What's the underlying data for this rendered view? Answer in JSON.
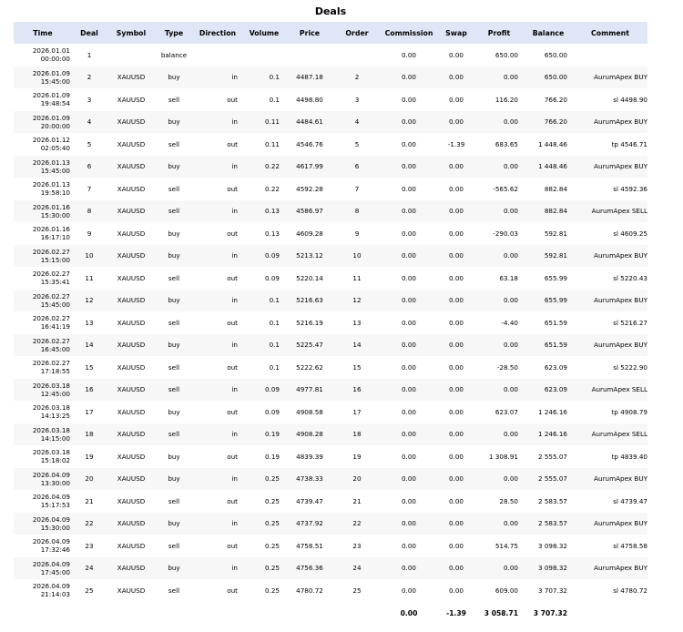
{
  "title": "Deals",
  "columns": [
    "Time",
    "Deal",
    "Symbol",
    "Type",
    "Direction",
    "Volume",
    "Price",
    "Order",
    "Commission",
    "Swap",
    "Profit",
    "Balance",
    "Comment"
  ],
  "rows": [
    {
      "date": "2026.01.01",
      "time": "00:00:00",
      "deal": "1",
      "symbol": "",
      "type": "balance",
      "direction": "",
      "volume": "",
      "price": "",
      "order": "",
      "commission": "0.00",
      "swap": "0.00",
      "profit": "650.00",
      "balance": "650.00",
      "comment": ""
    },
    {
      "date": "2026.01.09",
      "time": "15:45:00",
      "deal": "2",
      "symbol": "XAUUSD",
      "type": "buy",
      "direction": "in",
      "volume": "0.1",
      "price": "4487.18",
      "order": "2",
      "commission": "0.00",
      "swap": "0.00",
      "profit": "0.00",
      "balance": "650.00",
      "comment": "AurumApex BUY"
    },
    {
      "date": "2026.01.09",
      "time": "19:48:54",
      "deal": "3",
      "symbol": "XAUUSD",
      "type": "sell",
      "direction": "out",
      "volume": "0.1",
      "price": "4498.80",
      "order": "3",
      "commission": "0.00",
      "swap": "0.00",
      "profit": "116.20",
      "balance": "766.20",
      "comment": "sl 4498.90"
    },
    {
      "date": "2026.01.09",
      "time": "20:00:00",
      "deal": "4",
      "symbol": "XAUUSD",
      "type": "buy",
      "direction": "in",
      "volume": "0.11",
      "price": "4484.61",
      "order": "4",
      "commission": "0.00",
      "swap": "0.00",
      "profit": "0.00",
      "balance": "766.20",
      "comment": "AurumApex BUY"
    },
    {
      "date": "2026.01.12",
      "time": "02:05:40",
      "deal": "5",
      "symbol": "XAUUSD",
      "type": "sell",
      "direction": "out",
      "volume": "0.11",
      "price": "4546.76",
      "order": "5",
      "commission": "0.00",
      "swap": "-1.39",
      "profit": "683.65",
      "balance": "1 448.46",
      "comment": "tp 4546.71"
    },
    {
      "date": "2026.01.13",
      "time": "15:45:00",
      "deal": "6",
      "symbol": "XAUUSD",
      "type": "buy",
      "direction": "in",
      "volume": "0.22",
      "price": "4617.99",
      "order": "6",
      "commission": "0.00",
      "swap": "0.00",
      "profit": "0.00",
      "balance": "1 448.46",
      "comment": "AurumApex BUY"
    },
    {
      "date": "2026.01.13",
      "time": "19:58:10",
      "deal": "7",
      "symbol": "XAUUSD",
      "type": "sell",
      "direction": "out",
      "volume": "0.22",
      "price": "4592.28",
      "order": "7",
      "commission": "0.00",
      "swap": "0.00",
      "profit": "-565.62",
      "balance": "882.84",
      "comment": "sl 4592.36"
    },
    {
      "date": "2026.01.16",
      "time": "15:30:00",
      "deal": "8",
      "symbol": "XAUUSD",
      "type": "sell",
      "direction": "in",
      "volume": "0.13",
      "price": "4586.97",
      "order": "8",
      "commission": "0.00",
      "swap": "0.00",
      "profit": "0.00",
      "balance": "882.84",
      "comment": "AurumApex SELL"
    },
    {
      "date": "2026.01.16",
      "time": "16:17:10",
      "deal": "9",
      "symbol": "XAUUSD",
      "type": "buy",
      "direction": "out",
      "volume": "0.13",
      "price": "4609.28",
      "order": "9",
      "commission": "0.00",
      "swap": "0.00",
      "profit": "-290.03",
      "balance": "592.81",
      "comment": "sl 4609.25"
    },
    {
      "date": "2026.02.27",
      "time": "15:15:00",
      "deal": "10",
      "symbol": "XAUUSD",
      "type": "buy",
      "direction": "in",
      "volume": "0.09",
      "price": "5213.12",
      "order": "10",
      "commission": "0.00",
      "swap": "0.00",
      "profit": "0.00",
      "balance": "592.81",
      "comment": "AurumApex BUY"
    },
    {
      "date": "2026.02.27",
      "time": "15:35:41",
      "deal": "11",
      "symbol": "XAUUSD",
      "type": "sell",
      "direction": "out",
      "volume": "0.09",
      "price": "5220.14",
      "order": "11",
      "commission": "0.00",
      "swap": "0.00",
      "profit": "63.18",
      "balance": "655.99",
      "comment": "sl 5220.43"
    },
    {
      "date": "2026.02.27",
      "time": "15:45:00",
      "deal": "12",
      "symbol": "XAUUSD",
      "type": "buy",
      "direction": "in",
      "volume": "0.1",
      "price": "5216.63",
      "order": "12",
      "commission": "0.00",
      "swap": "0.00",
      "profit": "0.00",
      "balance": "655.99",
      "comment": "AurumApex BUY"
    },
    {
      "date": "2026.02.27",
      "time": "16:41:19",
      "deal": "13",
      "symbol": "XAUUSD",
      "type": "sell",
      "direction": "out",
      "volume": "0.1",
      "price": "5216.19",
      "order": "13",
      "commission": "0.00",
      "swap": "0.00",
      "profit": "-4.40",
      "balance": "651.59",
      "comment": "sl 5216.27"
    },
    {
      "date": "2026.02.27",
      "time": "16:45:00",
      "deal": "14",
      "symbol": "XAUUSD",
      "type": "buy",
      "direction": "in",
      "volume": "0.1",
      "price": "5225.47",
      "order": "14",
      "commission": "0.00",
      "swap": "0.00",
      "profit": "0.00",
      "balance": "651.59",
      "comment": "AurumApex BUY"
    },
    {
      "date": "2026.02.27",
      "time": "17:18:55",
      "deal": "15",
      "symbol": "XAUUSD",
      "type": "sell",
      "direction": "out",
      "volume": "0.1",
      "price": "5222.62",
      "order": "15",
      "commission": "0.00",
      "swap": "0.00",
      "profit": "-28.50",
      "balance": "623.09",
      "comment": "sl 5222.90"
    },
    {
      "date": "2026.03.18",
      "time": "12:45:00",
      "deal": "16",
      "symbol": "XAUUSD",
      "type": "sell",
      "direction": "in",
      "volume": "0.09",
      "price": "4977.81",
      "order": "16",
      "commission": "0.00",
      "swap": "0.00",
      "profit": "0.00",
      "balance": "623.09",
      "comment": "AurumApex SELL"
    },
    {
      "date": "2026.03.18",
      "time": "14:13:25",
      "deal": "17",
      "symbol": "XAUUSD",
      "type": "buy",
      "direction": "out",
      "volume": "0.09",
      "price": "4908.58",
      "order": "17",
      "commission": "0.00",
      "swap": "0.00",
      "profit": "623.07",
      "balance": "1 246.16",
      "comment": "tp 4908.79"
    },
    {
      "date": "2026.03.18",
      "time": "14:15:00",
      "deal": "18",
      "symbol": "XAUUSD",
      "type": "sell",
      "direction": "in",
      "volume": "0.19",
      "price": "4908.28",
      "order": "18",
      "commission": "0.00",
      "swap": "0.00",
      "profit": "0.00",
      "balance": "1 246.16",
      "comment": "AurumApex SELL"
    },
    {
      "date": "2026.03.18",
      "time": "15:18:02",
      "deal": "19",
      "symbol": "XAUUSD",
      "type": "buy",
      "direction": "out",
      "volume": "0.19",
      "price": "4839.39",
      "order": "19",
      "commission": "0.00",
      "swap": "0.00",
      "profit": "1 308.91",
      "balance": "2 555.07",
      "comment": "tp 4839.40"
    },
    {
      "date": "2026.04.09",
      "time": "13:30:00",
      "deal": "20",
      "symbol": "XAUUSD",
      "type": "buy",
      "direction": "in",
      "volume": "0.25",
      "price": "4738.33",
      "order": "20",
      "commission": "0.00",
      "swap": "0.00",
      "profit": "0.00",
      "balance": "2 555.07",
      "comment": "AurumApex BUY"
    },
    {
      "date": "2026.04.09",
      "time": "15:17:53",
      "deal": "21",
      "symbol": "XAUUSD",
      "type": "sell",
      "direction": "out",
      "volume": "0.25",
      "price": "4739.47",
      "order": "21",
      "commission": "0.00",
      "swap": "0.00",
      "profit": "28.50",
      "balance": "2 583.57",
      "comment": "sl 4739.47"
    },
    {
      "date": "2026.04.09",
      "time": "15:30:00",
      "deal": "22",
      "symbol": "XAUUSD",
      "type": "buy",
      "direction": "in",
      "volume": "0.25",
      "price": "4737.92",
      "order": "22",
      "commission": "0.00",
      "swap": "0.00",
      "profit": "0.00",
      "balance": "2 583.57",
      "comment": "AurumApex BUY"
    },
    {
      "date": "2026.04.09",
      "time": "17:32:46",
      "deal": "23",
      "symbol": "XAUUSD",
      "type": "sell",
      "direction": "out",
      "volume": "0.25",
      "price": "4758.51",
      "order": "23",
      "commission": "0.00",
      "swap": "0.00",
      "profit": "514.75",
      "balance": "3 098.32",
      "comment": "sl 4758.58"
    },
    {
      "date": "2026.04.09",
      "time": "17:45:00",
      "deal": "24",
      "symbol": "XAUUSD",
      "type": "buy",
      "direction": "in",
      "volume": "0.25",
      "price": "4756.36",
      "order": "24",
      "commission": "0.00",
      "swap": "0.00",
      "profit": "0.00",
      "balance": "3 098.32",
      "comment": "AurumApex BUY"
    },
    {
      "date": "2026.04.09",
      "time": "21:14:03",
      "deal": "25",
      "symbol": "XAUUSD",
      "type": "sell",
      "direction": "out",
      "volume": "0.25",
      "price": "4780.72",
      "order": "25",
      "commission": "0.00",
      "swap": "0.00",
      "profit": "609.00",
      "balance": "3 707.32",
      "comment": "sl 4780.72"
    }
  ],
  "totals": {
    "commission": "0.00",
    "swap": "-1.39",
    "profit": "3 058.71",
    "balance": "3 707.32"
  }
}
